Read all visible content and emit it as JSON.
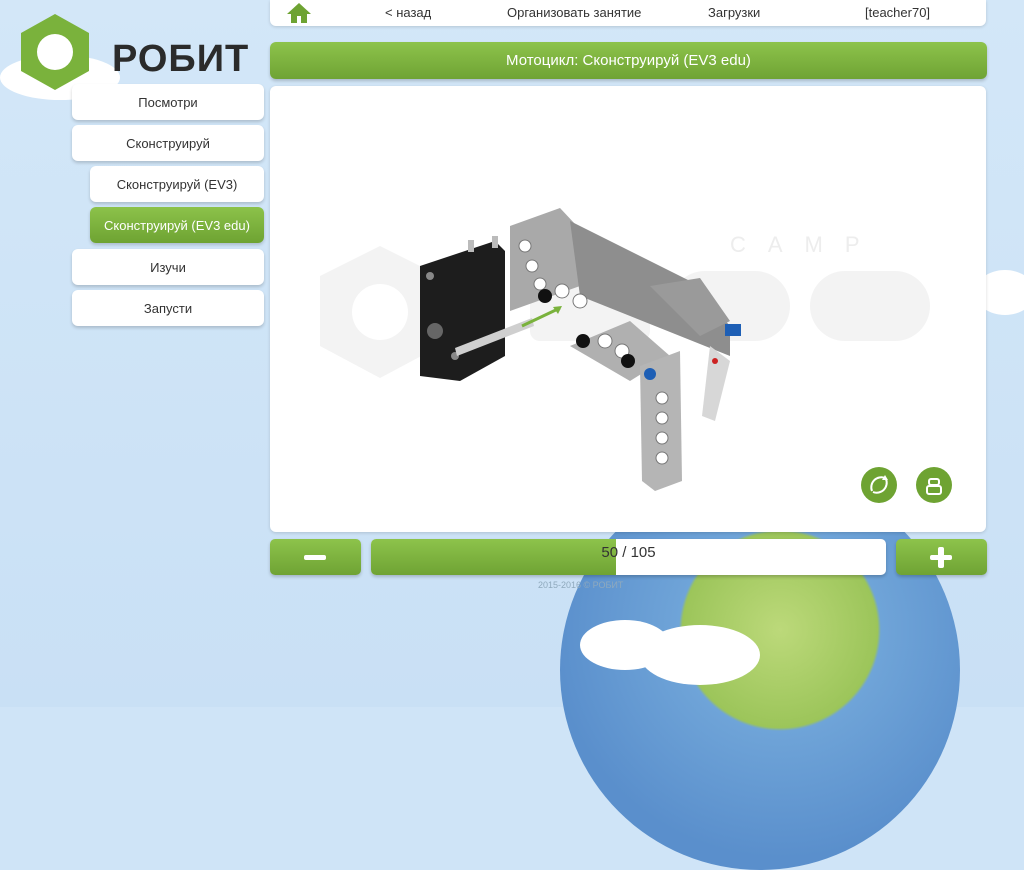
{
  "nav": {
    "back": "< назад",
    "organize": "Организовать занятие",
    "downloads": "Загрузки",
    "user": "[teacher70]"
  },
  "logo": {
    "text": "РОБИТ"
  },
  "sidebar": {
    "items": [
      {
        "label": "Посмотри"
      },
      {
        "label": "Сконструируй"
      },
      {
        "label": "Сконструируй (EV3)"
      },
      {
        "label": "Сконструируй (EV3 edu)"
      },
      {
        "label": "Изучи"
      },
      {
        "label": "Запусти"
      }
    ]
  },
  "title": "Мотоцикл: Сконструируй (EV3 edu)",
  "watermark": {
    "top": "CAMP"
  },
  "pager": {
    "current": "50",
    "separator": " / ",
    "total": "105",
    "progress": 0.476
  },
  "footer": {
    "copyright": "2015-2016 © РОБИТ"
  },
  "colors": {
    "accent": "#7ab23c",
    "background": "#cfe4f7"
  }
}
